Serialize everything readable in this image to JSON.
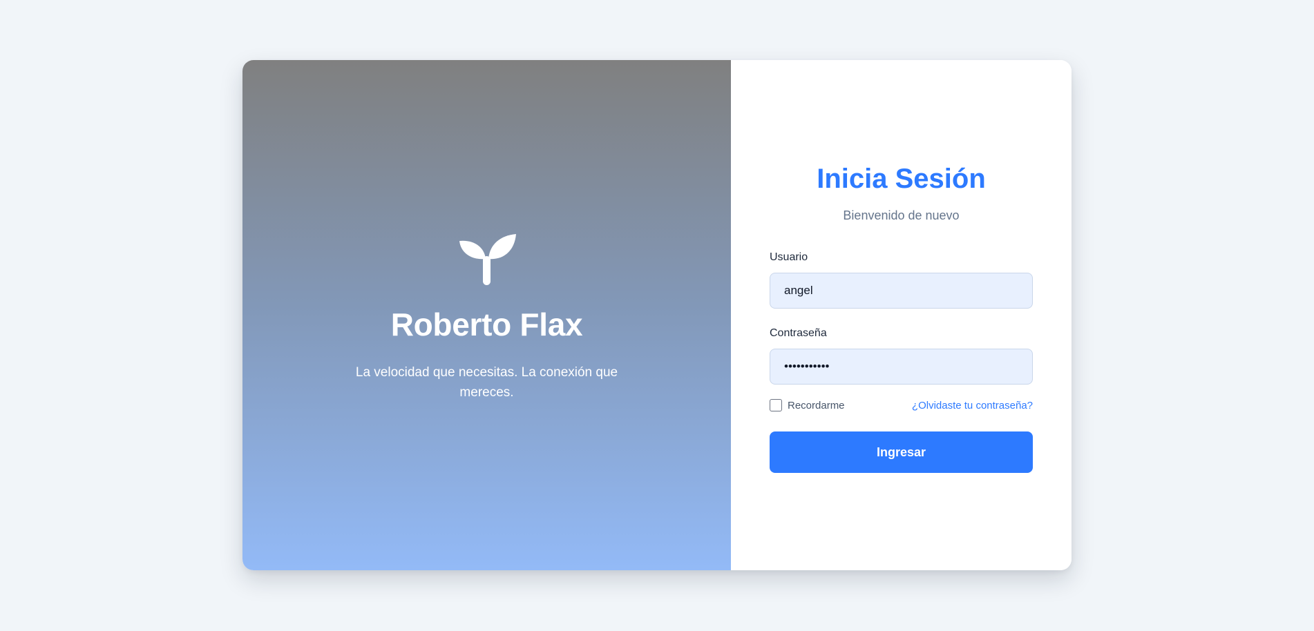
{
  "brand": {
    "logo_icon": "sprout-icon",
    "name": "Roberto Flax",
    "tagline": "La velocidad que necesitas. La conexión que mereces."
  },
  "form": {
    "title": "Inicia Sesión",
    "subtitle": "Bienvenido de nuevo",
    "username": {
      "label": "Usuario",
      "value": "angel"
    },
    "password": {
      "label": "Contraseña",
      "value": "•••••••••••"
    },
    "remember_label": "Recordarme",
    "remember_checked": false,
    "forgot_label": "¿Olvidaste tu contraseña?",
    "submit_label": "Ingresar"
  },
  "colors": {
    "accent": "#2d7aff",
    "page_background": "#f1f5f9",
    "input_background": "#e8f0fe",
    "panel_gradient_top": "#808080",
    "panel_gradient_bottom": "#93baf7"
  }
}
